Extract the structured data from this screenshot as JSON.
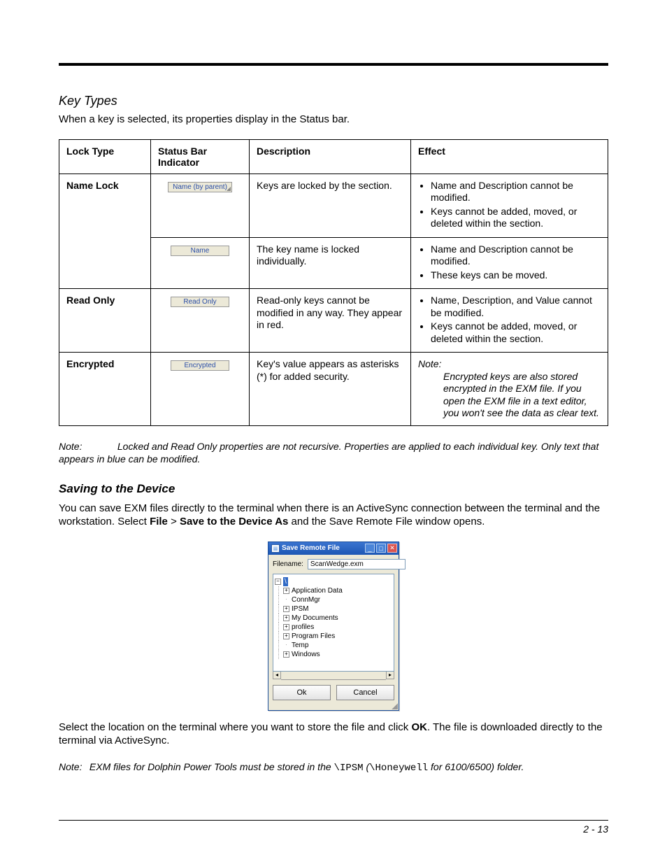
{
  "headings": {
    "key_types": "Key Types",
    "saving": "Saving to the Device"
  },
  "intro": {
    "key_types": "When a key is selected, its properties display in the Status bar."
  },
  "table": {
    "headers": {
      "lock_type": "Lock Type",
      "status_bar": "Status Bar Indicator",
      "description": "Description",
      "effect": "Effect"
    },
    "rows": {
      "name_lock": {
        "type": "Name Lock",
        "chip1": "Name (by parent)",
        "desc1": "Keys are locked by the section.",
        "eff1a": "Name and Description cannot be modified.",
        "eff1b": "Keys cannot be added, moved, or deleted within the section.",
        "chip2": "Name",
        "desc2": "The key name is locked individually.",
        "eff2a": "Name and Description cannot be modified.",
        "eff2b": "These keys can be moved."
      },
      "read_only": {
        "type": "Read Only",
        "chip": "Read Only",
        "desc": "Read-only keys cannot be modified in any way. They appear in red.",
        "eff_a": "Name, Description, and Value cannot be modified.",
        "eff_b": "Keys cannot be added, moved, or deleted within the section."
      },
      "encrypted": {
        "type": "Encrypted",
        "chip": "Encrypted",
        "desc": "Key's value appears as asterisks (*) for added security.",
        "note_label": "Note:",
        "note_body": "Encrypted keys are also stored encrypted in the EXM file. If you open the EXM file in a text editor, you won't see the data as clear text."
      }
    }
  },
  "note_after_table": {
    "label": "Note:",
    "body": "Locked and Read Only properties are not recursive. Properties are applied to each individual key. Only text that appears in blue can be modified."
  },
  "saving": {
    "para1_pre": "You can save EXM files directly to the terminal when there is an ActiveSync connection between the terminal and the workstation. Select ",
    "para1_file": "File",
    "para1_gt": " > ",
    "para1_save_as": "Save to the Device As",
    "para1_post": " and the Save Remote File window opens.",
    "para2_pre": "Select the location on the terminal where you want to store the file and click ",
    "para2_ok": "OK",
    "para2_post": ". The file is downloaded directly to the terminal via ActiveSync."
  },
  "note_exm": {
    "label": "Note:",
    "pre": "EXM files for Dolphin Power Tools must be stored in the ",
    "mono1": "\\IPSM",
    "paren_open": " (",
    "mono2": "\\Honeywell",
    "post": " for 6100/6500) folder."
  },
  "dialog": {
    "title": "Save Remote File",
    "filename_label": "Filename:",
    "filename_value": "ScanWedge.exm",
    "root": "\\",
    "items": {
      "app_data": "Application Data",
      "connmgr": "ConnMgr",
      "ipsm": "IPSM",
      "my_docs": "My Documents",
      "profiles": "profiles",
      "program_files": "Program Files",
      "temp": "Temp",
      "windows": "Windows"
    },
    "ok": "Ok",
    "cancel": "Cancel"
  },
  "page_number": "2 - 13"
}
